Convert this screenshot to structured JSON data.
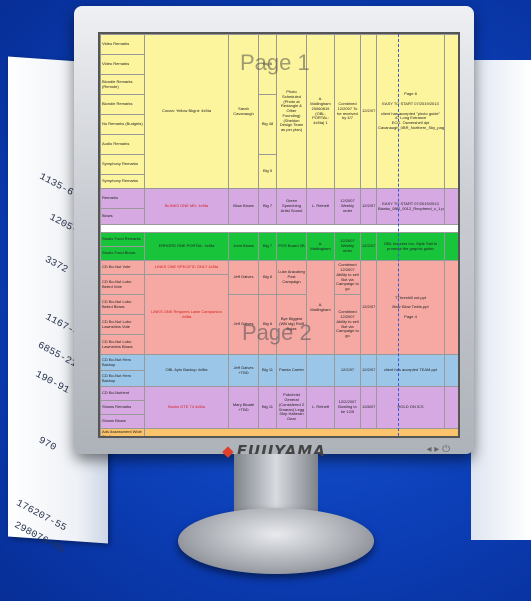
{
  "brand": "FUJIYAMA",
  "watermarks": {
    "page1": "Page 1",
    "page2": "Page 2"
  },
  "sheet": {
    "yellow_rows": [
      "Video Remarks",
      "Video Remarks",
      "Blondie Remarks (Remote)",
      "Blondie Remarks",
      "No Remarks (Budgets)",
      "Audio Remarks",
      "Symphony Remarks",
      "Symphony Remarks"
    ],
    "yellow_main": "Conan: Yellow Bkgrd: 4x5ta",
    "yellow_person": "Sarah Cavanaugh",
    "yellow_days": [
      "Big 6",
      "Big 48",
      "Big 5"
    ],
    "yellow_detail": "Photo Scheduled (Photo at Redangle & Other Founding) (Sheldon Design Team as per plan)",
    "yellow_person2": "A. Mallingham 20060819 (OBL. PORTAL: 4x5ta) 1",
    "yellow_status": "Combined 12/2007 To be received by 4/7",
    "yellow_date": "12/2/07",
    "yellow_right": [
      "Page 8",
      "EASY TO START 07/2019/2013",
      "client has accepted \"photo guide\"",
      "47 Long Entrance",
      "ECG. Ownershell dpt",
      "Cavanaugh_0BR_Northern_Sky_page01.ppt"
    ],
    "purple_rows": [
      "Remarks",
      "Blows"
    ],
    "purple_main": "BLINKS ONE MD: 4x5ta",
    "purple_person": "Blow Blows",
    "purple_day": "Big 7",
    "purple_detail": "Green Speeching Artist Sound",
    "purple_person2": "L. Relnett",
    "purple_status": "12/2007 Weekly order",
    "purple_date": "12/2/07",
    "purple_right": [
      "EASY TO START 07/2019/2013",
      "Blanks_0BR_0012_Recphend_v_1.ppt"
    ],
    "green_rows": [
      "Studio Fund Remarks",
      "Studio Fund Blows"
    ],
    "green_main": "ERRORS ONE PORTAL: 4x5ta",
    "green_person": "John Blows",
    "green_day": "Big 7",
    "green_detail": "POS Board 2B",
    "green_person2": "A. Mallingham",
    "green_status": "12/2007 Weekly order",
    "green_date": "12/2/07",
    "green_right": "OBL Insurers Inc; Style Sail to promote the graphic gutter",
    "pink_rows": [
      "CD Bo-Nut Vote",
      "CD Bo-Nut Lobo Bebrd Vote",
      "CD Bo-Nut Lobo Bebrd Blows",
      "CD Bo-Nut Lobo Lawnshins Vote",
      "CD Bo-Nut Lobo Lawnshins Blows"
    ],
    "pink_main1": "LINKS ONE SPECIFIC ONLY 4x5ta",
    "pink_main2": "LINKS ONE Requires Lawn Campanion 4x5ta",
    "pink_person": "Jeff Galves",
    "pink_day": "Big 6",
    "pink_detail1": "Luke Aracabeg Post Campaign",
    "pink_detail2": "Bye Biggest (Will stg) Rollf Bojas",
    "pink_person2": "A. Mallingham",
    "pink_status1": "Combined 12/2007 Ability to sell Bot via Campaign to go",
    "pink_status2": "Combined 12/2007 Ability to sell Bot via Campaign to go",
    "pink_date": "12/2/07",
    "pink_right": [
      "TThreshill out.ppt",
      "Bear Blow Twirls.ppt",
      "Page 4"
    ],
    "blue_rows": [
      "CD Bo-Nut Hero Backup",
      "CD Bo-Nut Hero Backup"
    ],
    "blue_main": "OBL Ayto Backup 4x5ta",
    "blue_person": "Jeff Galves +TBD",
    "blue_day": "Big 11",
    "blue_detail": "Panda Carrier",
    "blue_person2": "",
    "blue_date": "12/2/07",
    "blue_date2": "12/2/07",
    "blue_right": "client has accepted TEAM.ppt",
    "purple2_rows": [
      "CD Bo-Nutrient",
      "Shows Remarks",
      "Shows Blows"
    ],
    "purple2_main": "Books DTE 74 4x5ta",
    "purple2_person": "Mary Bloate +TBD",
    "purple2_day": "Big 11",
    "purple2_detail": "Pubchrist General (Considered 2 Smaran) Legg Ship Halteran Gear",
    "purple2_person2": "L. Relnett",
    "purple2_status": "12/2/2007 Bowling to be 12/5",
    "purple2_date": "12/8/07",
    "purple2_right": "HOLD ON ICS",
    "orange_row": "Ads Assessment Wide Studio"
  }
}
